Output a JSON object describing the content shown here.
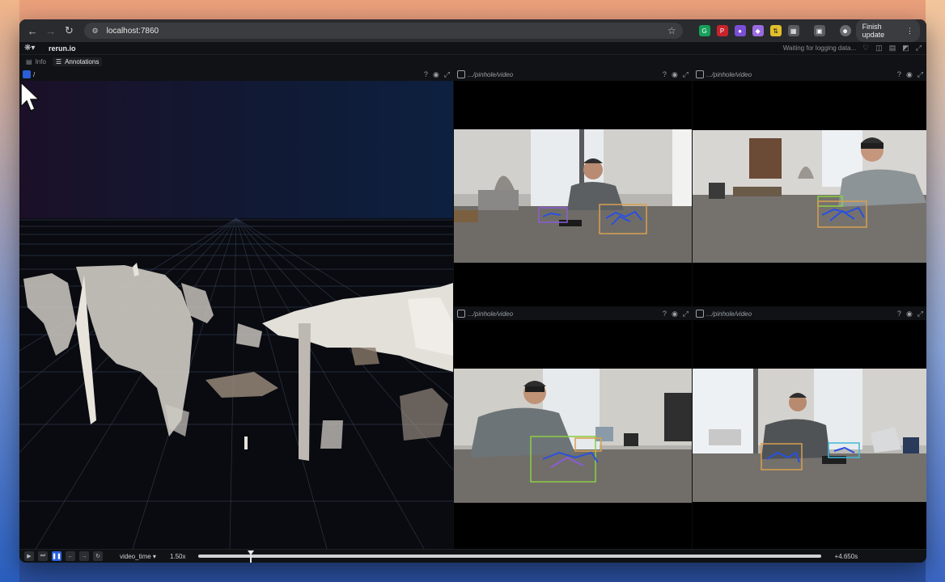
{
  "browser": {
    "url": "localhost:7860",
    "finish_update_label": "Finish update",
    "extensions": [
      {
        "icon": "grammarly-icon",
        "color": "#15a05a"
      },
      {
        "icon": "pinterest-icon",
        "color": "#c8232c"
      },
      {
        "icon": "extension-purple-icon",
        "color": "#7a4fd6"
      },
      {
        "icon": "extension-gem-icon",
        "color": "#9a6be0"
      },
      {
        "icon": "extension-yellow-icon",
        "color": "#e2c02b"
      },
      {
        "icon": "puzzle-icon",
        "color": "#5a5c60"
      }
    ]
  },
  "app": {
    "name": "rerun.io",
    "status": "Waiting for logging data...",
    "tabs": [
      {
        "label": "Info",
        "icon": "info-icon",
        "active": false
      },
      {
        "label": "Annotations",
        "icon": "list-icon",
        "active": true
      }
    ]
  },
  "panes": {
    "main": {
      "path": "/",
      "icon": "3d-view-icon"
    },
    "video1": {
      "path": ".../pinhole/video"
    },
    "video2": {
      "path": ".../pinhole/video"
    },
    "video3": {
      "path": ".../pinhole/video"
    },
    "video4": {
      "path": ".../pinhole/video"
    }
  },
  "timeline": {
    "timeline_name": "video_time",
    "speed": "1.50x",
    "time_label": "+4.650s",
    "playhead_fraction": 0.085
  },
  "colors": {
    "accent": "#2b5fd9",
    "bbox_purple": "#8a5cd6",
    "bbox_orange": "#d8a050",
    "bbox_green": "#8ccf40",
    "bbox_cyan": "#3fb8d8",
    "skeleton_blue": "#2a50e0"
  }
}
